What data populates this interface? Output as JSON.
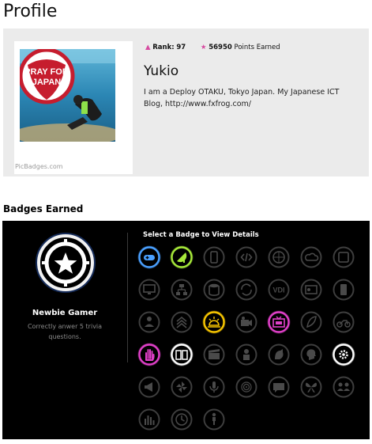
{
  "page": {
    "title": "Profile"
  },
  "profile": {
    "rank_label": "Rank:",
    "rank_value": "97",
    "points_value": "56950",
    "points_label": "Points Earned",
    "name": "Yukio",
    "bio": "I am a Deploy OTAKU, Tokyo Japan. My Japanese ICT Blog, http://www.fxfrog.com/",
    "avatar": {
      "sticker_line1": "PRAY FOR",
      "sticker_line2": "JAPAN",
      "credit": "PicBadges.com"
    }
  },
  "badges": {
    "section_title": "Badges Earned",
    "grid_title": "Select a Badge to View Details",
    "selected": {
      "name": "Newbie Gamer",
      "description": "Correctly anwer 5 trivia questions.",
      "icon": "star-badge-icon"
    },
    "colors": {
      "gray": "#4a4a4a",
      "blue": "#4aa0ff",
      "green": "#a6e83a",
      "yellow": "#f5c400",
      "magenta": "#e040c8",
      "white": "#ffffff"
    },
    "items": [
      {
        "icon": "gamepad-icon",
        "color": "blue",
        "earned": true
      },
      {
        "icon": "satellite-dish-icon",
        "color": "green",
        "earned": true
      },
      {
        "icon": "smartphone-icon",
        "color": "gray",
        "earned": false
      },
      {
        "icon": "code-icon",
        "color": "gray",
        "earned": false
      },
      {
        "icon": "globe-icon",
        "color": "gray",
        "earned": false
      },
      {
        "icon": "cloud-icon",
        "color": "gray",
        "earned": false
      },
      {
        "icon": "tablet-icon",
        "color": "gray",
        "earned": false
      },
      {
        "icon": "monitor-icon",
        "color": "gray",
        "earned": false
      },
      {
        "icon": "network-icon",
        "color": "gray",
        "earned": false
      },
      {
        "icon": "database-icon",
        "color": "gray",
        "earned": false
      },
      {
        "icon": "sync-icon",
        "color": "gray",
        "earned": false
      },
      {
        "icon": "vdi-icon",
        "color": "gray",
        "earned": false
      },
      {
        "icon": "id-card-icon",
        "color": "gray",
        "earned": false
      },
      {
        "icon": "phone-icon",
        "color": "gray",
        "earned": false
      },
      {
        "icon": "user-book-icon",
        "color": "gray",
        "earned": false
      },
      {
        "icon": "chevrons-up-icon",
        "color": "gray",
        "earned": false
      },
      {
        "icon": "sunrise-icon",
        "color": "yellow",
        "earned": true
      },
      {
        "icon": "camera-icon",
        "color": "gray",
        "earned": false
      },
      {
        "icon": "tv-icon",
        "color": "magenta",
        "earned": true
      },
      {
        "icon": "feather-icon",
        "color": "gray",
        "earned": false
      },
      {
        "icon": "motorcycle-icon",
        "color": "gray",
        "earned": false
      },
      {
        "icon": "hand-icon",
        "color": "magenta",
        "earned": true
      },
      {
        "icon": "book-icon",
        "color": "white",
        "earned": true
      },
      {
        "icon": "clapperboard-icon",
        "color": "gray",
        "earned": false
      },
      {
        "icon": "person-icon",
        "color": "gray",
        "earned": false
      },
      {
        "icon": "rooster-icon",
        "color": "gray",
        "earned": false
      },
      {
        "icon": "head-icon",
        "color": "gray",
        "earned": false
      },
      {
        "icon": "gear-icon",
        "color": "white",
        "earned": true
      },
      {
        "icon": "megaphone-icon",
        "color": "gray",
        "earned": false
      },
      {
        "icon": "pinwheel-icon",
        "color": "gray",
        "earned": false
      },
      {
        "icon": "microphone-icon",
        "color": "gray",
        "earned": false
      },
      {
        "icon": "fingerprint-icon",
        "color": "gray",
        "earned": false
      },
      {
        "icon": "chat-bubble-icon",
        "color": "gray",
        "earned": false
      },
      {
        "icon": "butterfly-icon",
        "color": "gray",
        "earned": false
      },
      {
        "icon": "group-icon",
        "color": "gray",
        "earned": false
      },
      {
        "icon": "equalizer-icon",
        "color": "gray",
        "earned": false
      },
      {
        "icon": "clock-icon",
        "color": "gray",
        "earned": false
      },
      {
        "icon": "standing-person-icon",
        "color": "gray",
        "earned": false
      }
    ]
  }
}
